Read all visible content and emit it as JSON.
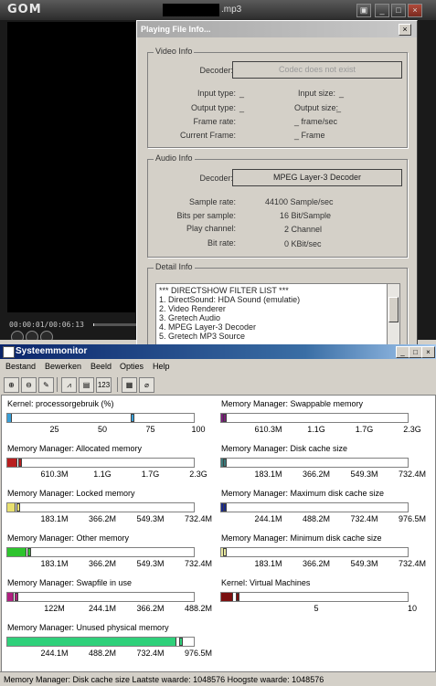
{
  "gom": {
    "logo": "GOM",
    "file_name": ".mp3",
    "time": "00:00:01/00:06:13",
    "seek_fraction": 0.01
  },
  "info": {
    "title": "Playing File Info...",
    "close": "×",
    "video": {
      "legend": "Video Info",
      "decoder_label": "Decoder:",
      "decoder_value": "Codec does not exist",
      "input_type_label": "Input type:",
      "input_type_value": "_",
      "input_size_label": "Input size:",
      "input_size_value": "_",
      "output_type_label": "Output type:",
      "output_type_value": "_",
      "output_size_label": "Output size:",
      "output_size_value": "_",
      "frame_rate_label": "Frame rate:",
      "frame_rate_value": "_ frame/sec",
      "current_frame_label": "Current Frame:",
      "current_frame_value": "_ Frame"
    },
    "audio": {
      "legend": "Audio Info",
      "decoder_label": "Decoder:",
      "decoder_value": "MPEG Layer-3 Decoder",
      "sample_rate_label": "Sample rate:",
      "sample_rate_value": "44100 Sample/sec",
      "bits_label": "Bits per sample:",
      "bits_value": "16 Bit/Sample",
      "channel_label": "Play channel:",
      "channel_value": "2 Channel",
      "bitrate_label": "Bit rate:",
      "bitrate_value": "0 KBit/sec"
    },
    "detail": {
      "legend": "Detail Info",
      "lines": [
        "*** DIRECTSHOW FILTER LIST ***",
        "1. DirectSound: HDA Sound    (emulatie)",
        "2. Video Renderer",
        "3. Gretech Audio",
        "4. MPEG Layer-3 Decoder",
        "5. Gretech MP3 Source"
      ]
    }
  },
  "sysmon": {
    "title": "Systeemmonitor",
    "window_buttons": [
      "_",
      "□",
      "×"
    ],
    "menu": [
      "Bestand",
      "Bewerken",
      "Beeld",
      "Opties",
      "Help"
    ],
    "status": "Memory Manager: Disk cache size   Laatste waarde: 1048576  Hoogste waarde: 1048576",
    "gauges": [
      {
        "title": "Kernel: processorgebruik (%)",
        "fill": 0.02,
        "peak": 0.66,
        "color": "#3aa0d8",
        "ticks": [
          "25",
          "50",
          "75",
          "100"
        ]
      },
      {
        "title": "Memory Manager: Swappable memory",
        "fill": 0.01,
        "peak": 0.01,
        "color": "#7a1f7a",
        "ticks": [
          "610.3M",
          "1.1G",
          "1.7G",
          "2.3G"
        ]
      },
      {
        "title": "Memory Manager: Allocated memory",
        "fill": 0.05,
        "peak": 0.06,
        "color": "#b81e1e",
        "ticks": [
          "610.3M",
          "1.1G",
          "1.7G",
          "2.3G"
        ]
      },
      {
        "title": "Memory Manager: Disk cache size",
        "fill": 0.01,
        "peak": 0.01,
        "color": "#3a7a7a",
        "ticks": [
          "183.1M",
          "366.2M",
          "549.3M",
          "732.4M"
        ]
      },
      {
        "title": "Memory Manager: Locked memory",
        "fill": 0.04,
        "peak": 0.05,
        "color": "#e8e070",
        "ticks": [
          "183.1M",
          "366.2M",
          "549.3M",
          "732.4M"
        ]
      },
      {
        "title": "Memory Manager: Maximum disk cache size",
        "fill": 0.01,
        "peak": 0.01,
        "color": "#1a2a8a",
        "ticks": [
          "244.1M",
          "488.2M",
          "732.4M",
          "976.5M"
        ]
      },
      {
        "title": "Memory Manager: Other memory",
        "fill": 0.1,
        "peak": 0.11,
        "color": "#2ec42e",
        "ticks": [
          "183.1M",
          "366.2M",
          "549.3M",
          "732.4M"
        ]
      },
      {
        "title": "Memory Manager: Minimum disk cache size",
        "fill": 0.01,
        "peak": 0.01,
        "color": "#e8e8a0",
        "ticks": [
          "183.1M",
          "366.2M",
          "549.3M",
          "732.4M"
        ]
      },
      {
        "title": "Memory Manager: Swapfile in use",
        "fill": 0.03,
        "peak": 0.04,
        "color": "#b02080",
        "ticks": [
          "122M",
          "244.1M",
          "366.2M",
          "488.2M"
        ]
      },
      {
        "title": "Kernel: Virtual Machines",
        "fill": 0.06,
        "peak": 0.08,
        "color": "#7a1010",
        "ticks": [
          "5",
          "10"
        ]
      },
      {
        "title": "Memory Manager: Unused physical memory",
        "fill": 0.9,
        "peak": 0.92,
        "color": "#2fd07a",
        "ticks": [
          "244.1M",
          "488.2M",
          "732.4M",
          "976.5M"
        ]
      }
    ]
  }
}
